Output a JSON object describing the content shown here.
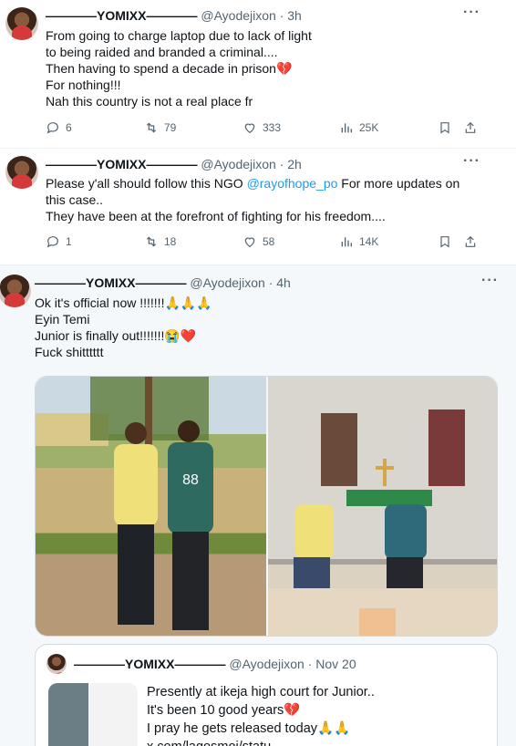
{
  "tweets": [
    {
      "name": "————YOMIXX————",
      "handle": "@Ayodejixon",
      "time": "· 3h",
      "lines": [
        "From going to charge laptop due to lack of light",
        "to being raided and branded a criminal....",
        "Then having to spend a decade in prison💔",
        "For nothing!!!",
        "Nah this country is not a real place fr"
      ],
      "replies": "6",
      "retweets": "79",
      "likes": "333",
      "views": "25K"
    },
    {
      "name": "————YOMIXX————",
      "handle": "@Ayodejixon",
      "time": "· 2h",
      "line1_pre": "Please y'all should follow this NGO ",
      "mention": "@rayofhope_po",
      "line1_post": "  For more updates on",
      "lines": [
        "this case..",
        "They have been at the forefront of fighting for his freedom...."
      ],
      "replies": "1",
      "retweets": "18",
      "likes": "58",
      "views": "14K"
    },
    {
      "name": "————YOMIXX————",
      "handle": "@Ayodejixon",
      "time": "· 4h",
      "lines": [
        "Ok it's official now !!!!!!!🙏🙏🙏",
        "Eyin Temi",
        "Junior is finally out!!!!!!!😭❤️",
        "Fuck shitttttt"
      ],
      "photo_shirt_text": "88"
    }
  ],
  "quote": {
    "name": "————YOMIXX————",
    "handle": "@Ayodejixon",
    "time": "· Nov 20",
    "lines": [
      "Presently at ikeja high court for Junior..",
      "It's been 10 good years💔",
      "I pray he gets released today🙏🙏",
      "x.com/lagosmoi/statu..."
    ]
  },
  "icons": {
    "reply": "reply-icon",
    "retweet": "retweet-icon",
    "like": "heart-icon",
    "views": "views-icon",
    "bookmark": "bookmark-icon",
    "share": "share-icon",
    "more": "more-icon"
  },
  "colors": {
    "text": "#0f1419",
    "muted": "#536471",
    "link": "#1d9bf0",
    "border": "#cfd9de"
  }
}
